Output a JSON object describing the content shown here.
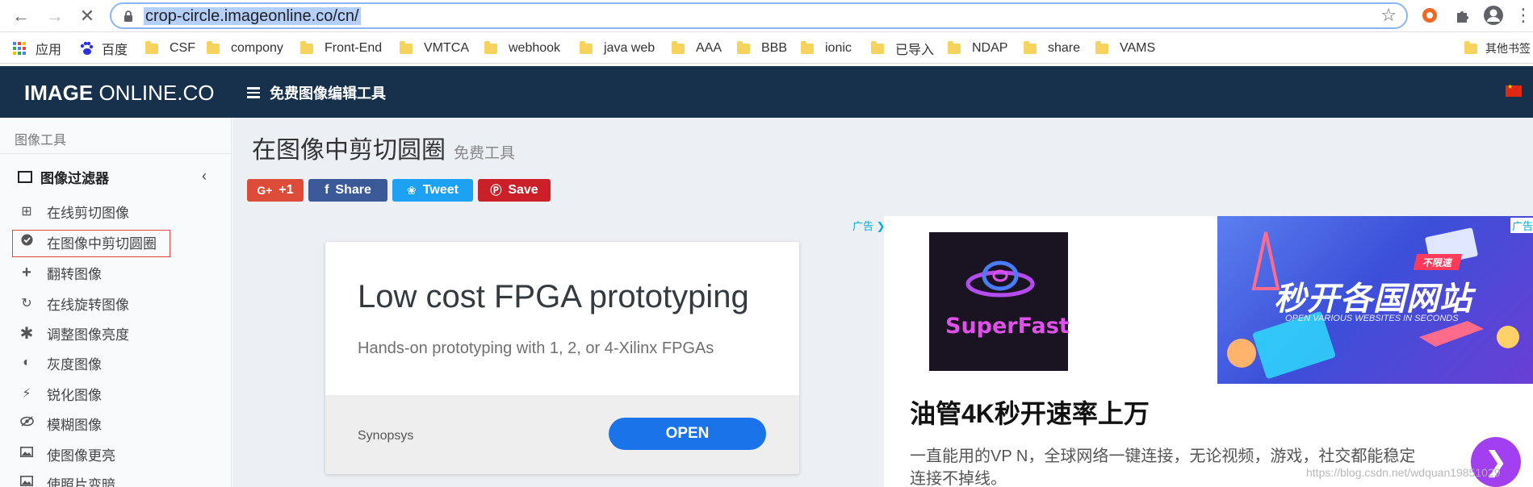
{
  "browser": {
    "url": "crop-circle.imageonline.co/cn/",
    "bookmarks": [
      {
        "label": "应用",
        "type": "apps"
      },
      {
        "label": "百度",
        "type": "baidu"
      },
      {
        "label": "CSF",
        "type": "folder"
      },
      {
        "label": "compony",
        "type": "folder"
      },
      {
        "label": "Front-End",
        "type": "folder"
      },
      {
        "label": "VMTCA",
        "type": "folder"
      },
      {
        "label": "webhook",
        "type": "folder"
      },
      {
        "label": "java web",
        "type": "folder"
      },
      {
        "label": "AAA",
        "type": "folder"
      },
      {
        "label": "BBB",
        "type": "folder"
      },
      {
        "label": "ionic",
        "type": "folder"
      },
      {
        "label": "已导入",
        "type": "folder"
      },
      {
        "label": "NDAP",
        "type": "folder"
      },
      {
        "label": "share",
        "type": "folder"
      },
      {
        "label": "VAMS",
        "type": "folder"
      },
      {
        "label": "其他书签",
        "type": "folder"
      }
    ]
  },
  "header": {
    "logo_bold": "IMAGE",
    "logo_rest": " ONLINE.CO",
    "menu_label": "免费图像编辑工具"
  },
  "sidebar": {
    "heading": "图像工具",
    "group_title": "图像过滤器",
    "items": [
      {
        "label": "在线剪切图像",
        "icon": "crop-icon"
      },
      {
        "label": "在图像中剪切圆圈",
        "icon": "check-circle-icon"
      },
      {
        "label": "翻转图像",
        "icon": "plus-icon"
      },
      {
        "label": "在线旋转图像",
        "icon": "rotate-icon"
      },
      {
        "label": "调整图像亮度",
        "icon": "asterisk-icon"
      },
      {
        "label": "灰度图像",
        "icon": "half-circle-icon"
      },
      {
        "label": "锐化图像",
        "icon": "bolt-icon"
      },
      {
        "label": "模糊图像",
        "icon": "eye-slash-icon"
      },
      {
        "label": "使图像更亮",
        "icon": "image-icon"
      },
      {
        "label": "使照片变暗",
        "icon": "image-icon"
      }
    ]
  },
  "main": {
    "title": "在图像中剪切圆圈",
    "title_badge": "免费工具",
    "share": {
      "gplus": "+1",
      "facebook": "Share",
      "twitter": "Tweet",
      "pinterest": "Save"
    }
  },
  "ads": {
    "card": {
      "headline": "Low cost FPGA prototyping",
      "sub": "Hands-on prototyping with 1, 2, or 4-Xilinx FPGAs",
      "brand": "Synopsys",
      "cta": "OPEN"
    },
    "right": {
      "tag": "广告",
      "logo_text": "SuperFast",
      "promo_title": "秒开各国网站",
      "promo_sub": "OPEN VARIOUS WEBSITES IN SECONDS",
      "promo_badge": "不限速",
      "title": "油管4K秒开速率上万",
      "desc": "一直能用的VP N，全球网络一键连接，无论视频，游戏，社交都能稳定连接不掉线。"
    }
  },
  "watermark": "https://blog.csdn.net/wdquan19851029",
  "colors": {
    "header_bg": "#17304b",
    "gplus": "#dd4b39",
    "facebook": "#3b5998",
    "twitter": "#1da1f2",
    "pinterest": "#cb2027",
    "cta": "#1a73e8"
  }
}
